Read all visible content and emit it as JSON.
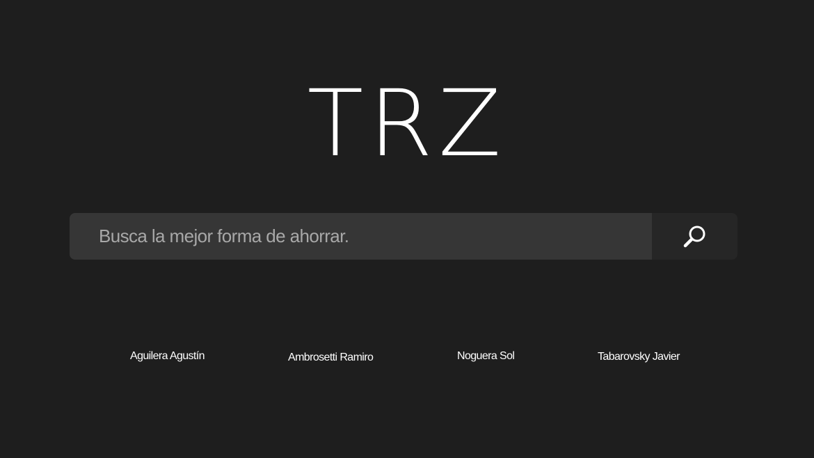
{
  "logo": {
    "text": "TRZ"
  },
  "search": {
    "placeholder": "Busca la mejor forma de ahorrar.",
    "value": "",
    "button_icon": "search-icon"
  },
  "credits": [
    "Aguilera Agustín",
    "Ambrosetti Ramiro",
    "Noguera Sol",
    "Tabarovsky Javier"
  ],
  "colors": {
    "background": "#1e1e1e",
    "search_field": "#363636",
    "search_button": "#262626",
    "placeholder_text": "#a8a8a8",
    "text": "#ffffff"
  }
}
